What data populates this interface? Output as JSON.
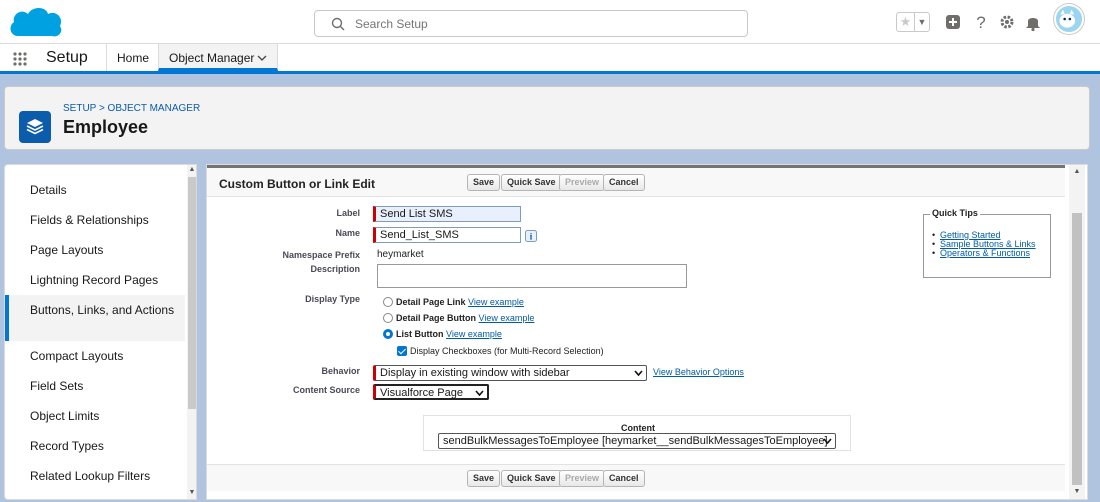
{
  "header": {
    "search_placeholder": "Search Setup",
    "icons": [
      "salesforce-cloud-logo",
      "search-icon",
      "star-icon",
      "chevron-down-icon",
      "plus-icon",
      "help-icon",
      "gear-icon",
      "bell-icon",
      "avatar"
    ]
  },
  "nav": {
    "app_name": "Setup",
    "tabs": [
      {
        "label": "Home"
      },
      {
        "label": "Object Manager"
      }
    ]
  },
  "page": {
    "breadcrumb": "SETUP > OBJECT MANAGER",
    "title": "Employee"
  },
  "sidebar": {
    "items": [
      {
        "label": "Details"
      },
      {
        "label": "Fields & Relationships"
      },
      {
        "label": "Page Layouts"
      },
      {
        "label": "Lightning Record Pages"
      },
      {
        "label": "Buttons, Links, and Actions"
      },
      {
        "label": "Compact Layouts"
      },
      {
        "label": "Field Sets"
      },
      {
        "label": "Object Limits"
      },
      {
        "label": "Record Types"
      },
      {
        "label": "Related Lookup Filters"
      }
    ]
  },
  "form": {
    "title": "Custom Button or Link Edit",
    "buttons": {
      "save": "Save",
      "quick_save": "Quick Save",
      "preview": "Preview",
      "cancel": "Cancel"
    },
    "label_label": "Label",
    "label_value": "Send List SMS",
    "name_label": "Name",
    "name_value": "Send_List_SMS",
    "namespace_label": "Namespace Prefix",
    "namespace_value": "heymarket",
    "description_label": "Description",
    "description_value": "",
    "display_type_label": "Display Type",
    "display_options": [
      {
        "label": "Detail Page Link",
        "link": "View example",
        "selected": false
      },
      {
        "label": "Detail Page Button",
        "link": "View example",
        "selected": false
      },
      {
        "label": "List Button",
        "link": "View example",
        "selected": true
      }
    ],
    "checkbox_label": "Display Checkboxes (for Multi-Record Selection)",
    "behavior_label": "Behavior",
    "behavior_value": "Display in existing window with sidebar",
    "behavior_link": "View Behavior Options",
    "content_source_label": "Content Source",
    "content_source_value": "Visualforce Page",
    "content_label": "Content",
    "content_value": "sendBulkMessagesToEmployee [heymarket__sendBulkMessagesToEmployee]",
    "quick_tips": {
      "title": "Quick Tips",
      "links": [
        "Getting Started",
        "Sample Buttons & Links",
        "Operators & Functions"
      ]
    }
  },
  "colors": {
    "brand": "#0176d3",
    "required": "#cc0000",
    "link": "#015ba7",
    "backdrop": "#b0c4df"
  }
}
